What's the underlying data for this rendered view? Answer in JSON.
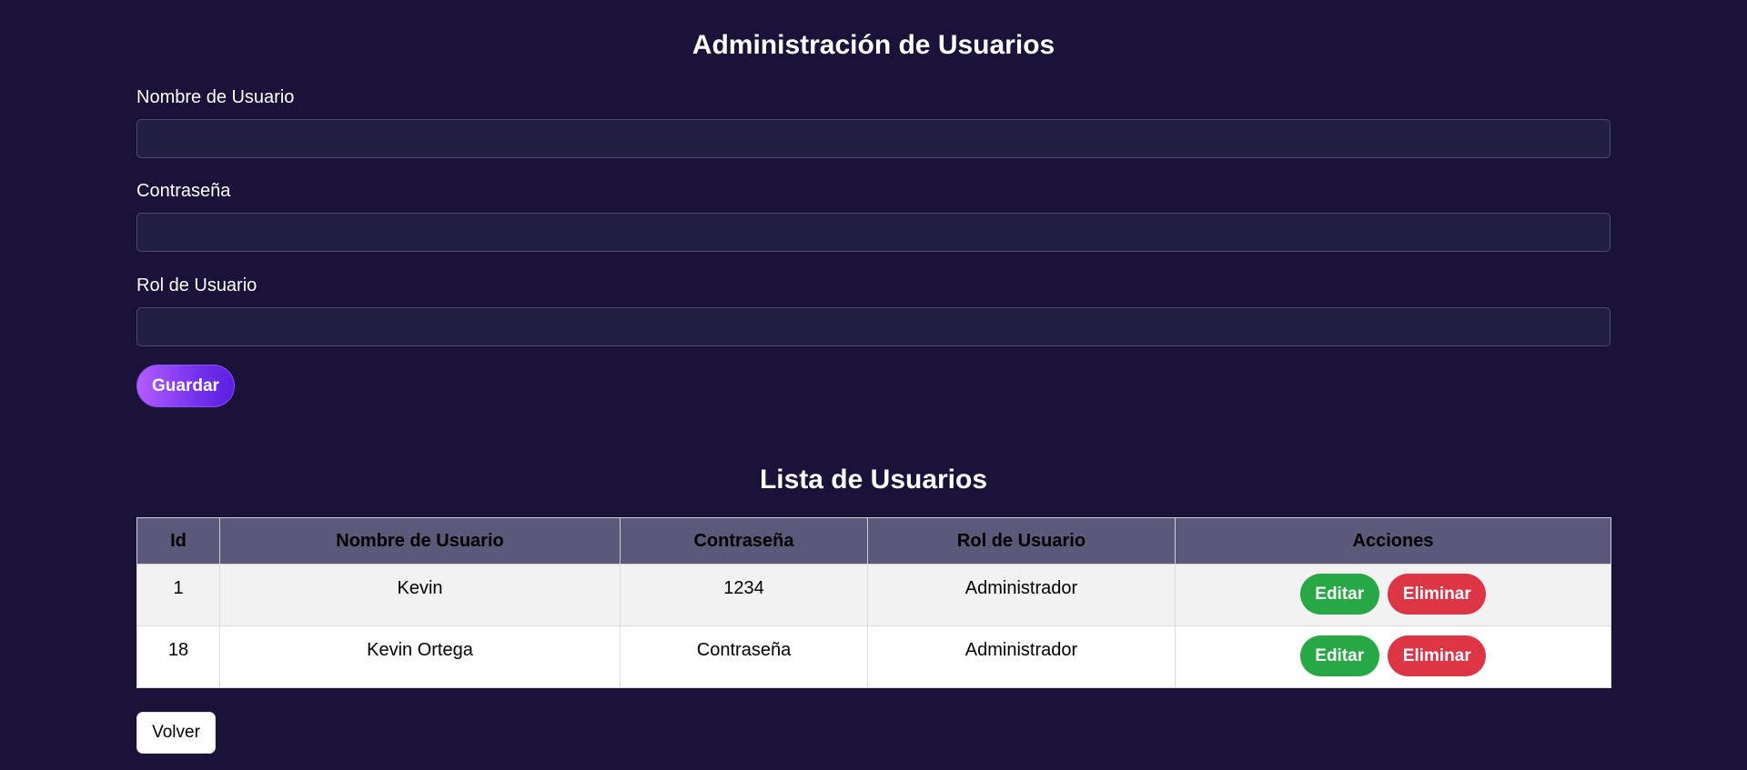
{
  "header": {
    "title": "Administración de Usuarios"
  },
  "form": {
    "username_label": "Nombre de Usuario",
    "username_value": "",
    "password_label": "Contraseña",
    "password_value": "",
    "role_label": "Rol de Usuario",
    "role_value": "",
    "save_label": "Guardar"
  },
  "users_list": {
    "title": "Lista de Usuarios",
    "columns": [
      "Id",
      "Nombre de Usuario",
      "Contraseña",
      "Rol de Usuario",
      "Acciones"
    ],
    "rows": [
      {
        "id": "1",
        "username": "Kevin",
        "password": "1234",
        "role": "Administrador",
        "edit_label": "Editar",
        "delete_label": "Eliminar"
      },
      {
        "id": "18",
        "username": "Kevin Ortega",
        "password": "Contraseña",
        "role": "Administrador",
        "edit_label": "Editar",
        "delete_label": "Eliminar"
      }
    ]
  },
  "footer": {
    "back_label": "Volver"
  },
  "colors": {
    "background": "#1a1238",
    "accent": "#7a36f0",
    "edit": "#28a745",
    "delete": "#dc3545",
    "table_header": "#5b5879"
  }
}
